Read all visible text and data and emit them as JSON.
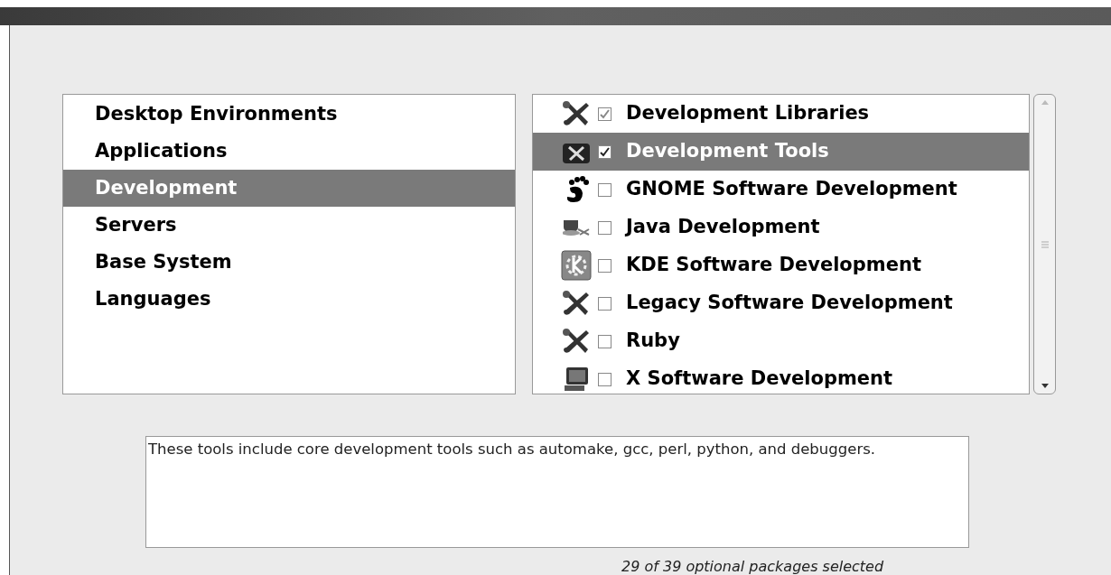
{
  "categories": [
    {
      "label": "Desktop Environments",
      "selected": false
    },
    {
      "label": "Applications",
      "selected": false
    },
    {
      "label": "Development",
      "selected": true
    },
    {
      "label": "Servers",
      "selected": false
    },
    {
      "label": "Base System",
      "selected": false
    },
    {
      "label": "Languages",
      "selected": false
    }
  ],
  "groups": [
    {
      "label": "Development Libraries",
      "kind": "tools",
      "checked": true,
      "selected": false
    },
    {
      "label": "Development Tools",
      "kind": "toolbox",
      "checked": true,
      "selected": true
    },
    {
      "label": "GNOME Software Development",
      "kind": "foot",
      "checked": false,
      "selected": false
    },
    {
      "label": "Java Development",
      "kind": "cup",
      "checked": false,
      "selected": false
    },
    {
      "label": "KDE Software Development",
      "kind": "kde",
      "checked": false,
      "selected": false
    },
    {
      "label": "Legacy Software Development",
      "kind": "tools",
      "checked": false,
      "selected": false
    },
    {
      "label": "Ruby",
      "kind": "tools",
      "checked": false,
      "selected": false
    },
    {
      "label": "X Software Development",
      "kind": "monitor",
      "checked": false,
      "selected": false
    }
  ],
  "description": "These tools include core development tools such as automake, gcc, perl, python, and debuggers.",
  "status": "29 of 39 optional packages selected"
}
